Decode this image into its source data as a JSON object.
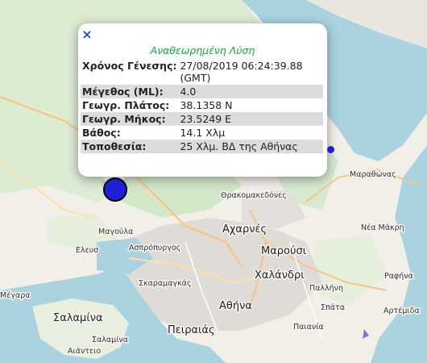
{
  "map": {
    "places": [
      {
        "name": "Αχαρνές"
      },
      {
        "name": "Μαρούσι"
      },
      {
        "name": "Χαλάνδρι"
      },
      {
        "name": "Αθήνα"
      },
      {
        "name": "Πειραιάς"
      },
      {
        "name": "Σαλαμίνα"
      },
      {
        "name": "Ασπρόπυργος"
      },
      {
        "name": "Σκαραμαγκάς"
      },
      {
        "name": "Μαγούλα"
      },
      {
        "name": "Θρακομακεδόνες"
      },
      {
        "name": "Μαραθώνας"
      },
      {
        "name": "Νέα Μάκρη"
      },
      {
        "name": "Παλλήνη"
      },
      {
        "name": "Ραφήνα"
      },
      {
        "name": "Σπάτα"
      },
      {
        "name": "Παιανία"
      },
      {
        "name": "Αρτέμιδα"
      },
      {
        "name": "Σαλαμίνα"
      },
      {
        "name": "Αιάντειο"
      },
      {
        "name": "Μέγαρα"
      },
      {
        "name": "Ελευσ"
      }
    ]
  },
  "popup": {
    "title": "Αναθεωρημένη Λύση",
    "close_label": "×",
    "rows": [
      {
        "key": "Χρόνος Γένεσης:",
        "value": "27/08/2019 06:24:39.88 (GMT)"
      },
      {
        "key": "Μέγεθος (ML):",
        "value": "4.0"
      },
      {
        "key": "Γεωγρ. Πλάτος:",
        "value": "38.1358 N"
      },
      {
        "key": "Γεωγρ. Μήκος:",
        "value": "23.5249 E"
      },
      {
        "key": "Βάθος:",
        "value": "14.1 Χλμ"
      },
      {
        "key": "Τοποθεσία:",
        "value": "25 Χλμ. ΒΔ της Αθήνας"
      }
    ]
  },
  "colors": {
    "sea": "#aad3df",
    "land": "#f2efe9",
    "forest": "#d6ead0",
    "urban": "#e0dfdf",
    "marker": "#1f1fd6",
    "title": "#1aa33b"
  }
}
